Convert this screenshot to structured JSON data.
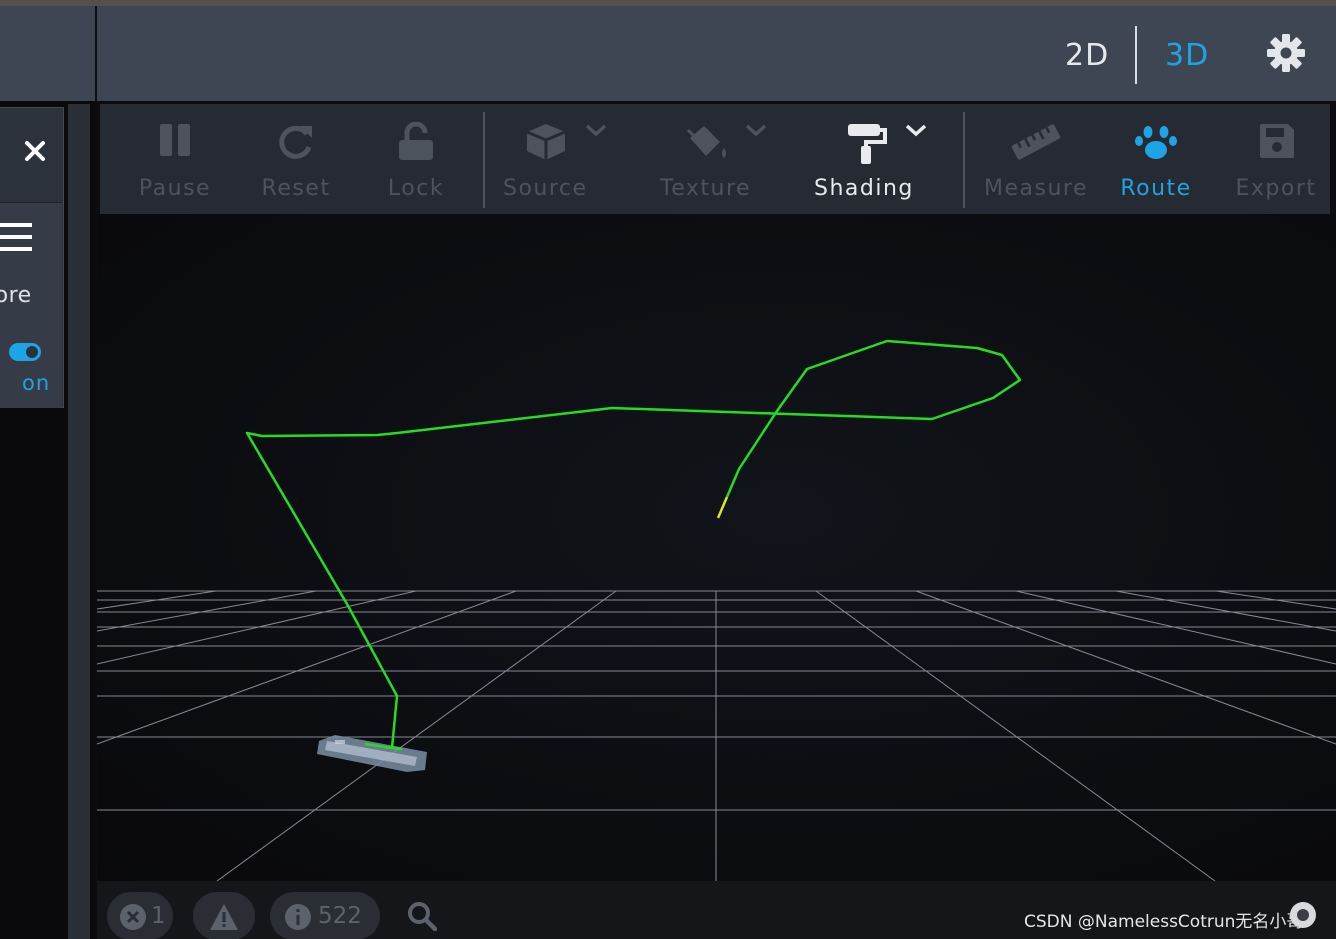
{
  "header": {
    "mode_2d": "2D",
    "mode_3d": "3D",
    "active_mode": "3D",
    "accent": "#1ea4e4"
  },
  "side_panel": {
    "close_icon": "close-icon",
    "menu_icon": "menu-icon",
    "more_label": "lore",
    "toggle_state": "on",
    "toggle_label": "on"
  },
  "toolbar": {
    "items": [
      {
        "label": "Pause",
        "icon": "pause-icon",
        "state": "disabled"
      },
      {
        "label": "Reset",
        "icon": "reset-icon",
        "state": "disabled"
      },
      {
        "label": "Lock",
        "icon": "lock-icon",
        "state": "disabled"
      },
      {
        "label": "Source",
        "icon": "cube-icon",
        "state": "disabled"
      },
      {
        "label": "Texture",
        "icon": "paint-bucket-icon",
        "state": "disabled"
      },
      {
        "label": "Shading",
        "icon": "paint-roller-icon",
        "state": "active"
      },
      {
        "label": "Measure",
        "icon": "ruler-icon",
        "state": "disabled"
      },
      {
        "label": "Route",
        "icon": "paw-icon",
        "state": "selected"
      },
      {
        "label": "Export",
        "icon": "save-icon",
        "state": "disabled"
      }
    ]
  },
  "viewport": {
    "route_color": "#22dd22",
    "route_end_color": "#d8e820",
    "grid_color": "#9aa0a8"
  },
  "statusbar": {
    "errors_count": "1",
    "info_count": "522",
    "watermark": "CSDN @NamelessCotrun无名小哥"
  }
}
